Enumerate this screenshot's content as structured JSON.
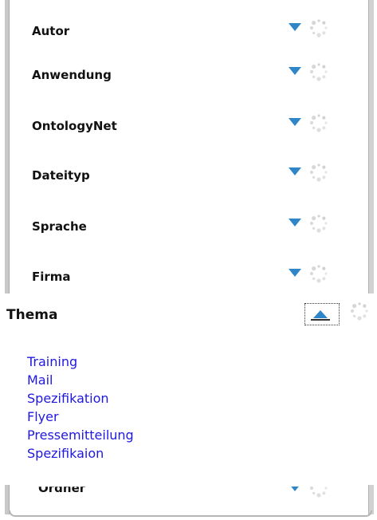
{
  "facets": [
    {
      "label": "Autor"
    },
    {
      "label": "Anwendung"
    },
    {
      "label": "OntologyNet"
    },
    {
      "label": "Dateityp"
    },
    {
      "label": "Sprache"
    },
    {
      "label": "Firma"
    }
  ],
  "popup": {
    "title": "Thema",
    "items": [
      "Training",
      "Mail",
      "Spezifikation",
      "Flyer",
      "Pressemitteilung",
      "Spezifikaion"
    ]
  },
  "hidden_facet": {
    "label": "Ordner"
  },
  "icons": {
    "expand": "chevron-down-icon",
    "collapse": "chevron-up-icon",
    "loading": "loading-spinner-icon"
  },
  "colors": {
    "link": "#1f18e0",
    "arrow": "#2e86c9",
    "spinner": "#cfcfcf"
  }
}
